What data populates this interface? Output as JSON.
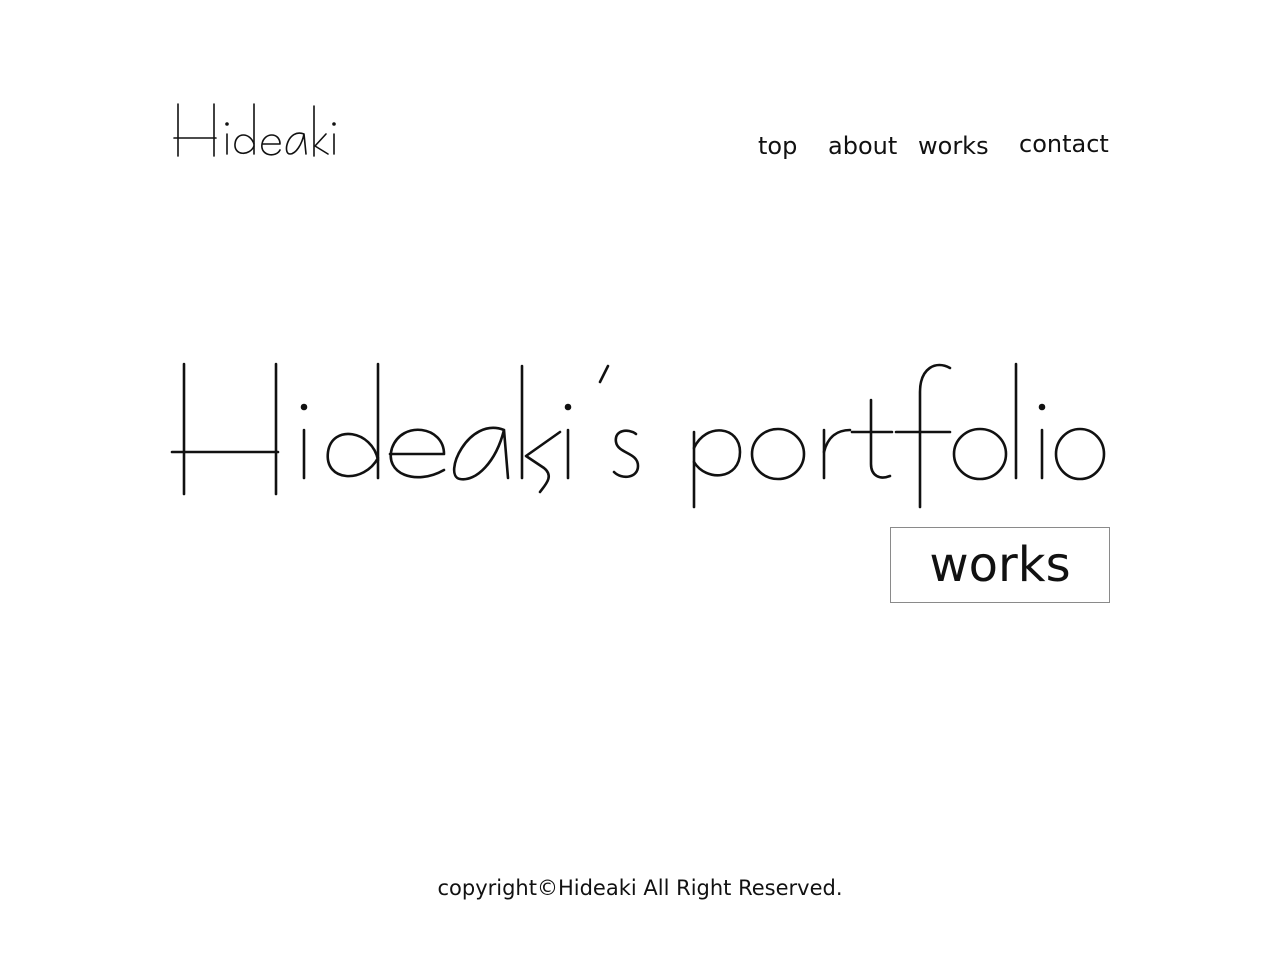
{
  "header": {
    "logo_text": "Hideaki",
    "nav": {
      "top": "top",
      "about": "about",
      "works": "works",
      "contact": "contact"
    }
  },
  "hero": {
    "title": "Hideaki’s portfolio",
    "button_label": "works"
  },
  "footer": {
    "copyright": "copyright©Hideaki All Right Reserved."
  },
  "colors": {
    "background": "#ffffff",
    "text": "#111111",
    "button_border": "#8a8a8a"
  }
}
